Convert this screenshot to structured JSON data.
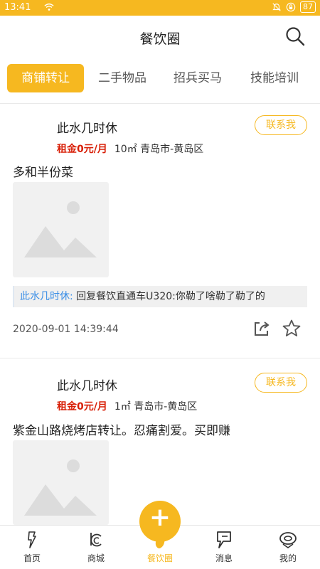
{
  "status_bar": {
    "time": "13:41",
    "battery": "87"
  },
  "header": {
    "title": "餐饮圈"
  },
  "tabs": [
    {
      "label": "商铺转让",
      "active": true
    },
    {
      "label": "二手物品",
      "active": false
    },
    {
      "label": "招兵买马",
      "active": false
    },
    {
      "label": "技能培训",
      "active": false
    }
  ],
  "posts": [
    {
      "user": "此水几时休",
      "contact_label": "联系我",
      "rent": "租金0元/月",
      "area": "10㎡",
      "location": "青岛市-黄岛区",
      "description": "多和半份菜",
      "reply_name": "此水几时休:",
      "reply_text": "回复餐饮直通车U320:你勒了啥勒了勒了的",
      "date": "2020-09-01 14:39:44"
    },
    {
      "user": "此水几时休",
      "contact_label": "联系我",
      "rent": "租金0元/月",
      "area": "1㎡",
      "location": "青岛市-黄岛区",
      "description": "紫金山路烧烤店转让。忍痛割爱。买即赚"
    }
  ],
  "fab": {
    "label": "+"
  },
  "bottom_nav": [
    {
      "label": "首页",
      "active": false
    },
    {
      "label": "商城",
      "active": false
    },
    {
      "label": "餐饮圈",
      "active": true
    },
    {
      "label": "消息",
      "active": false
    },
    {
      "label": "我的",
      "active": false
    }
  ],
  "colors": {
    "accent": "#f6b820",
    "rent": "#d81e06",
    "link": "#3a8ee6"
  }
}
